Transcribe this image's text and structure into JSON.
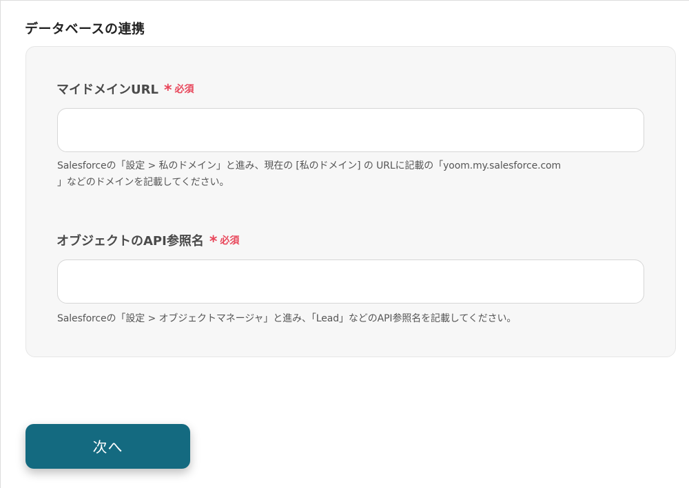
{
  "section": {
    "title": "データベースの連携"
  },
  "fields": [
    {
      "label": "マイドメインURL",
      "asterisk": "*",
      "required": "必須",
      "value": "",
      "help_line1": "Salesforceの「設定 > 私のドメイン」と進み、現在の [私のドメイン] の URLに記載の「yoom.my.salesforce.com",
      "help_line2": "」などのドメインを記載してください。"
    },
    {
      "label": "オブジェクトのAPI参照名",
      "asterisk": "*",
      "required": "必須",
      "value": "",
      "help_line1": "Salesforceの「設定 > オブジェクトマネージャ」と進み、「Lead」などのAPI参照名を記載してください。"
    }
  ],
  "actions": {
    "next_label": "次へ"
  },
  "colors": {
    "primary": "#146a80",
    "required": "#e8465a",
    "panel_bg": "#f7f7f7"
  }
}
